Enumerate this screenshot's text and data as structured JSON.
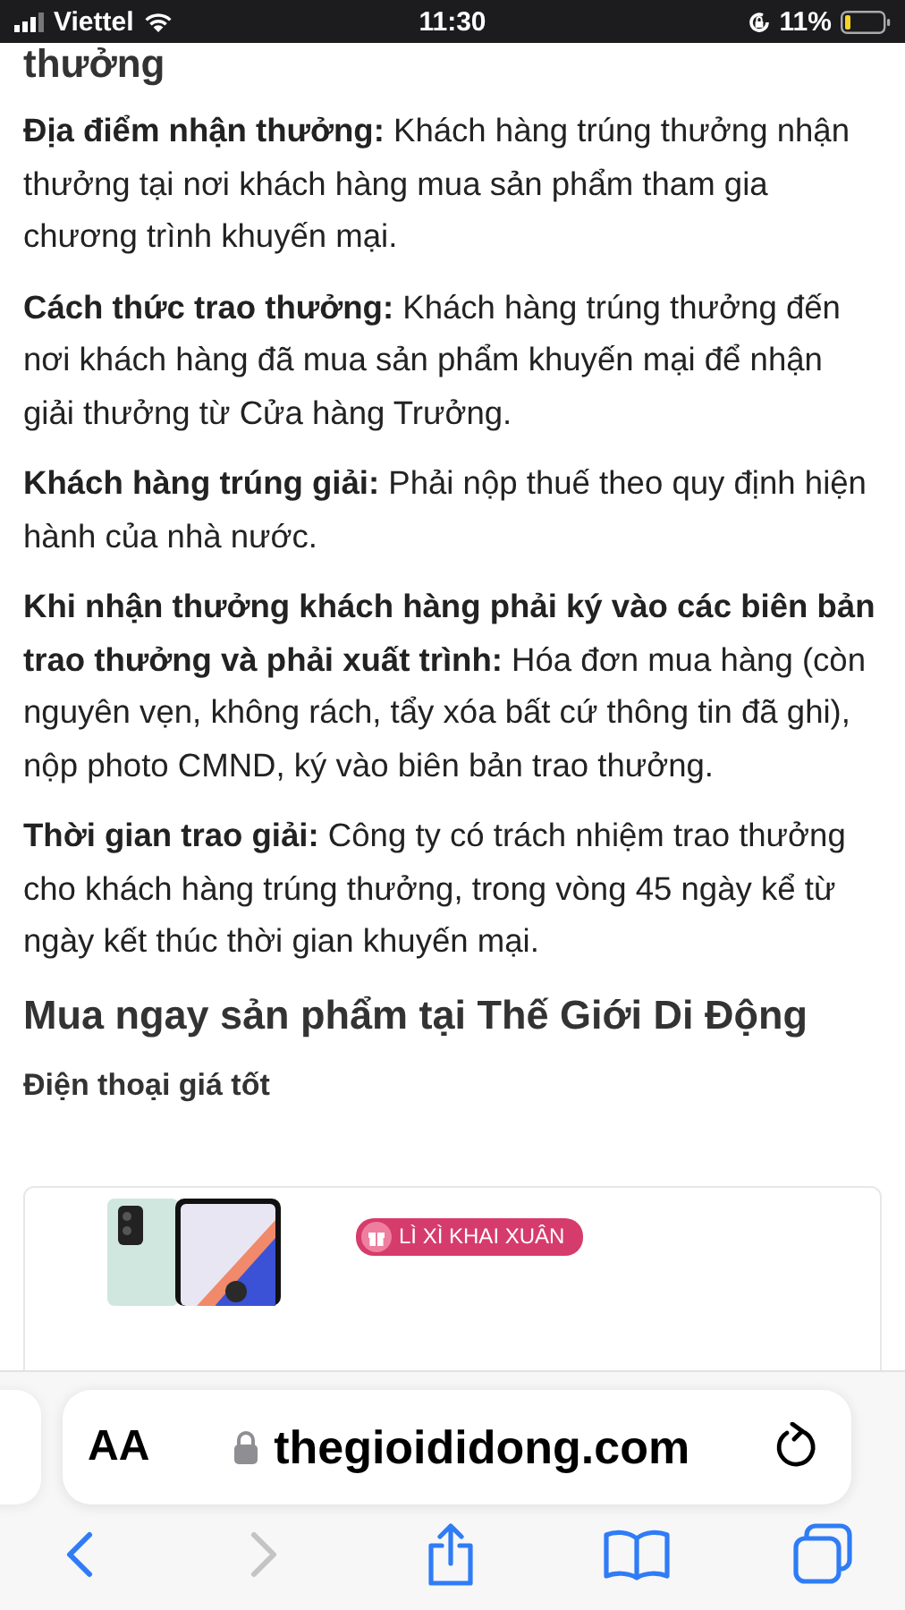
{
  "status_bar": {
    "carrier": "Viettel",
    "time": "11:30",
    "battery": "11%"
  },
  "article": {
    "cut_heading": "thưởng",
    "paragraphs": [
      "**Địa điểm nhận thưởng:** Khách hàng trúng thưởng nhận thưởng tại nơi khách hàng mua sản phẩm tham gia chương trình khuyến mại.",
      "**Cách thức trao thưởng:** Khách hàng trúng thưởng đến nơi khách hàng đã mua sản phẩm khuyến mại để nhận giải thưởng từ Cửa hàng Trưởng.",
      "**Khách hàng trúng giải:** Phải nộp thuế theo quy định hiện hành của nhà nước.",
      "**Khi nhận thưởng khách hàng phải ký vào các biên bản trao thưởng và phải xuất trình:** Hóa đơn mua hàng (còn nguyên vẹn, không rách, tẩy xóa bất cứ thông tin đã ghi), nộp photo CMND, ký vào biên bản trao thưởng.",
      "**Thời gian trao giải:** Công ty có trách nhiệm trao thưởng cho khách hàng trúng thưởng, trong vòng 45 ngày kể từ ngày kết thúc thời gian khuyến mại."
    ],
    "heading": "Mua ngay sản phẩm tại Thế Giới Di Động",
    "subheading": "Điện thoại giá tốt",
    "promo": {
      "kind": "picture",
      "badge": "LÌ XÌ KHAI XUÂN"
    }
  },
  "browser": {
    "text_size_button": "AA",
    "url": "thegioididong.com",
    "toolbar": [
      {
        "kind": "back",
        "disabled": false
      },
      {
        "kind": "forward",
        "disabled": true
      },
      {
        "kind": "share",
        "disabled": false
      },
      {
        "kind": "bookmarks",
        "disabled": false
      },
      {
        "kind": "tabs",
        "disabled": false
      }
    ]
  }
}
